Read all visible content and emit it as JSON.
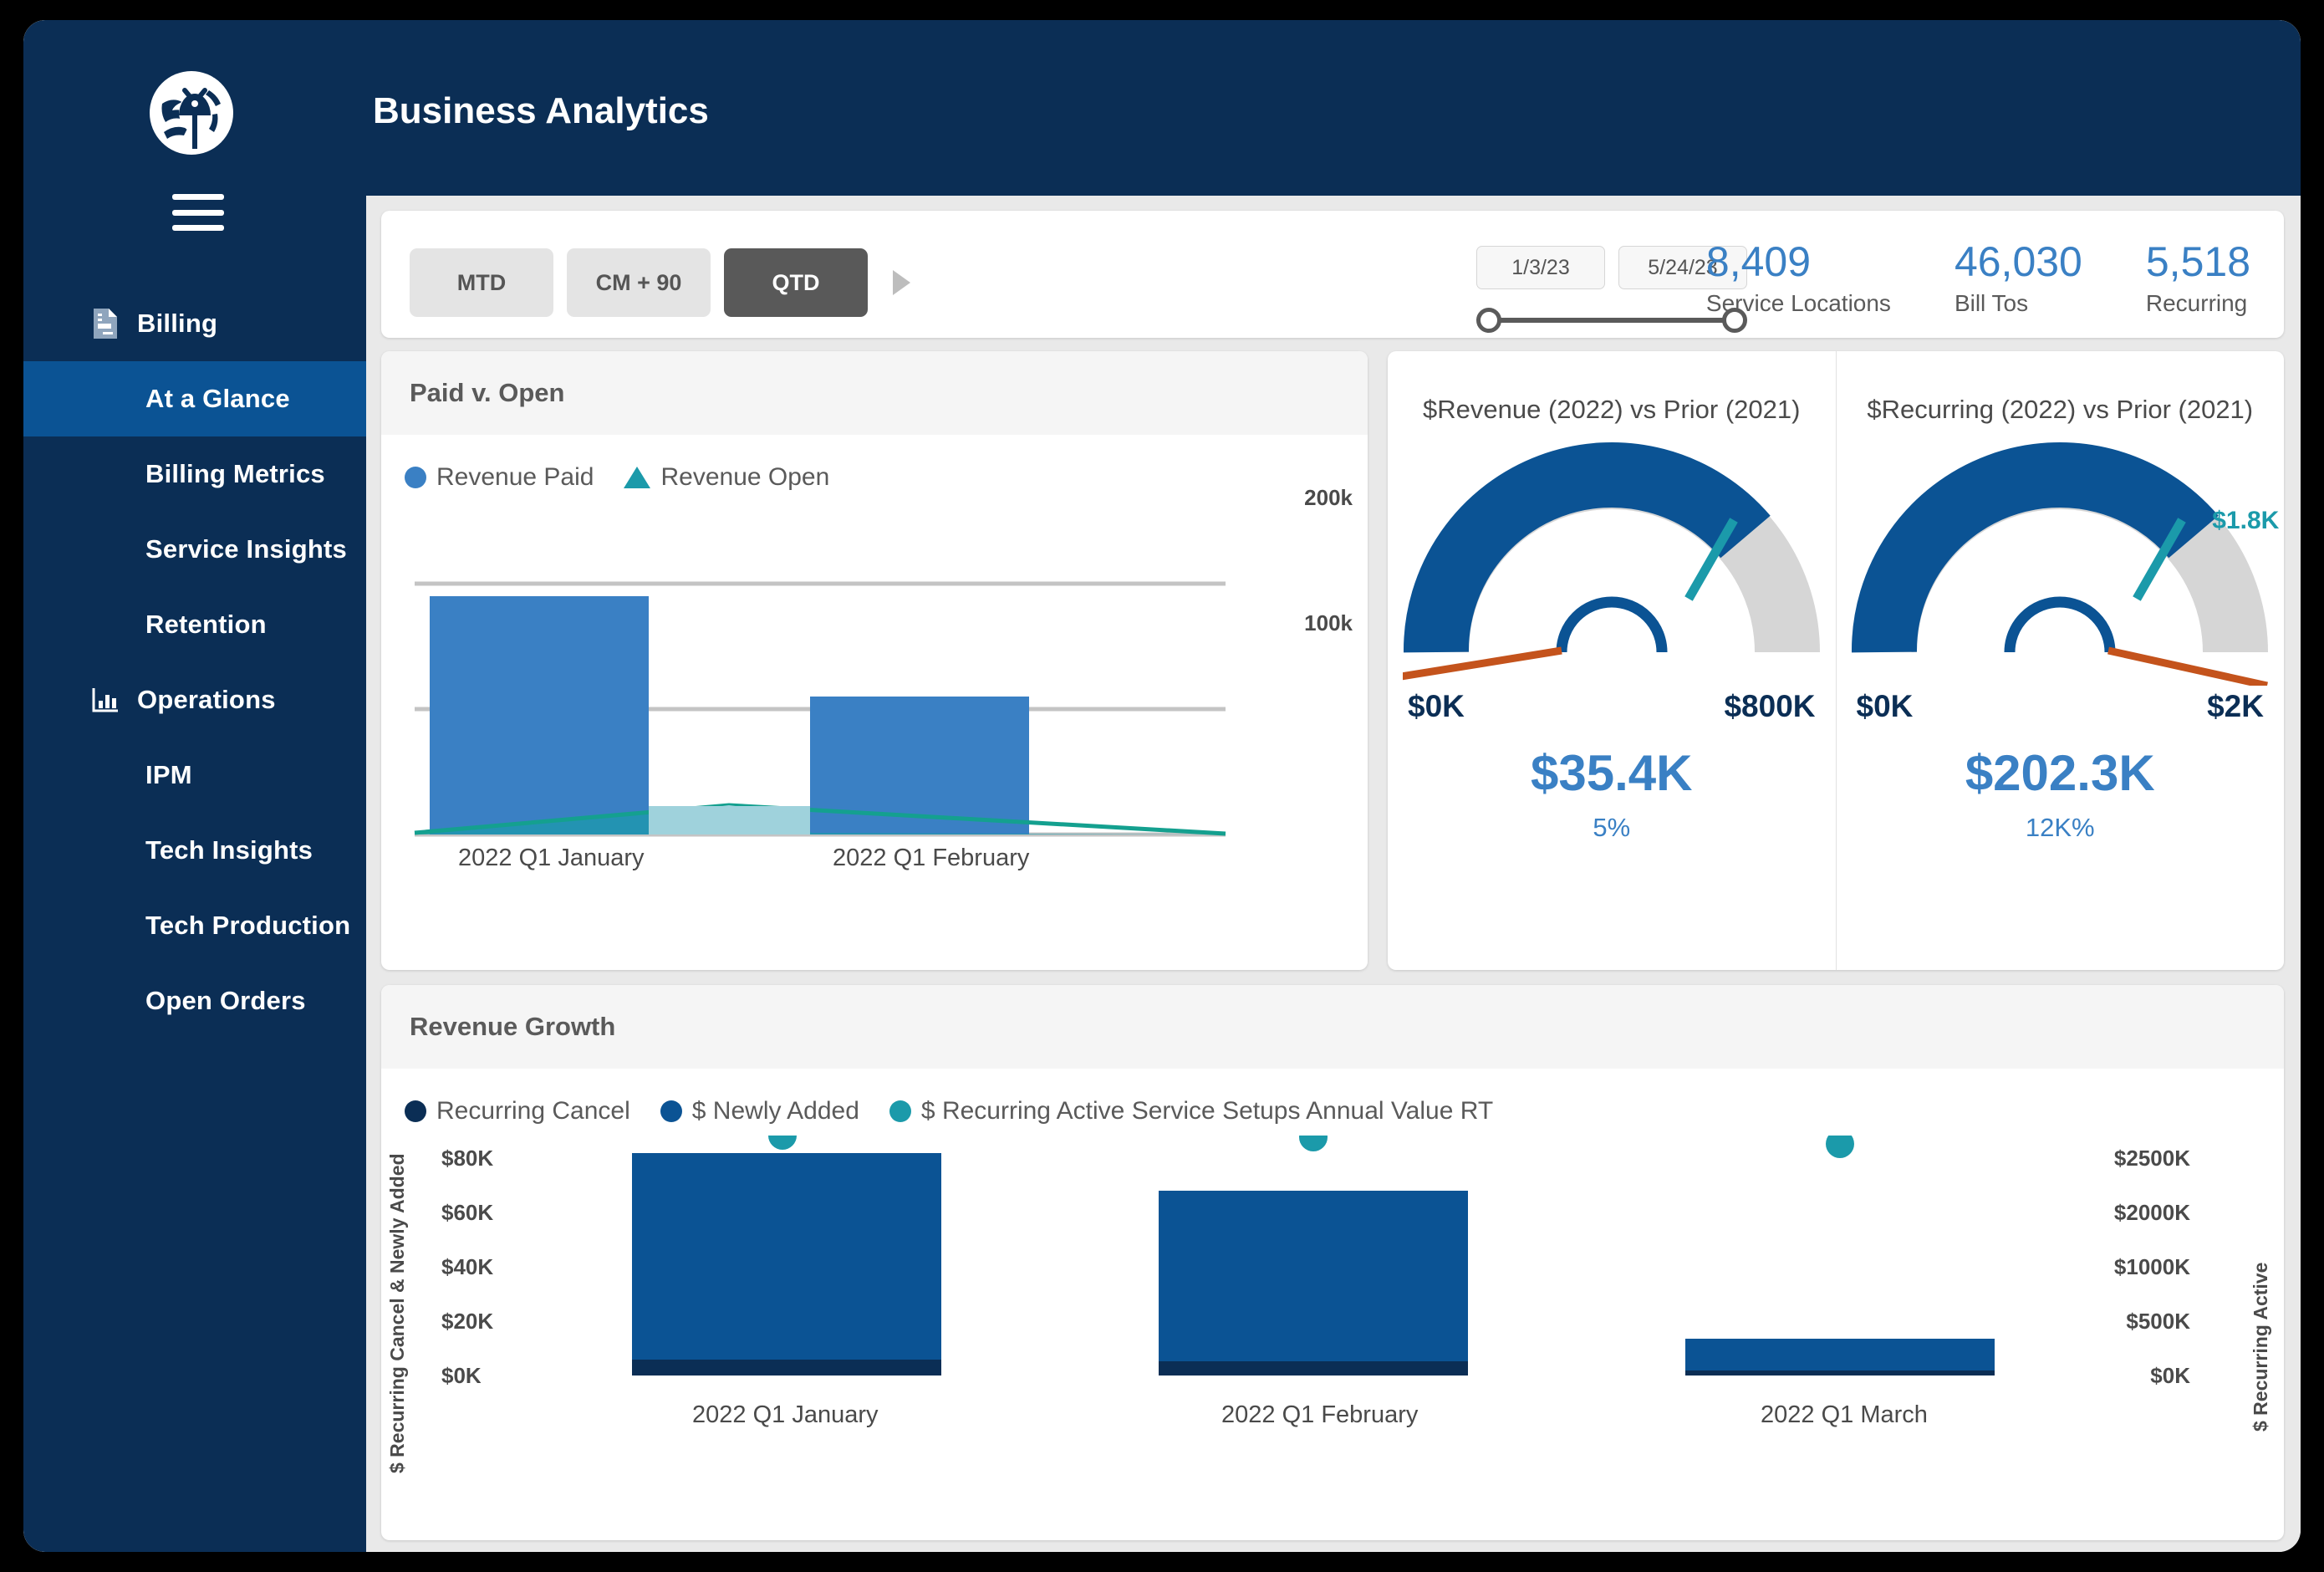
{
  "app": {
    "logo_icon": "globe-bug-logo",
    "menu_icon": "hamburger-menu-icon",
    "header_title": "Business Analytics"
  },
  "sidebar": {
    "items": [
      {
        "label": "Billing",
        "icon": "document-icon",
        "level": "section",
        "active": false
      },
      {
        "label": "At a Glance",
        "icon": "",
        "level": "child",
        "active": true
      },
      {
        "label": "Billing Metrics",
        "icon": "",
        "level": "child",
        "active": false
      },
      {
        "label": "Service Insights",
        "icon": "",
        "level": "child",
        "active": false
      },
      {
        "label": "Retention",
        "icon": "",
        "level": "child",
        "active": false
      },
      {
        "label": "Operations",
        "icon": "bar-chart-icon",
        "level": "section",
        "active": false
      },
      {
        "label": "IPM",
        "icon": "",
        "level": "child",
        "active": false
      },
      {
        "label": "Tech Insights",
        "icon": "",
        "level": "child",
        "active": false
      },
      {
        "label": "Tech Production",
        "icon": "",
        "level": "child",
        "active": false
      },
      {
        "label": "Open Orders",
        "icon": "",
        "level": "child",
        "active": false
      }
    ]
  },
  "filterbar": {
    "period_pills": [
      {
        "label": "MTD",
        "selected": false
      },
      {
        "label": "CM + 90",
        "selected": false
      },
      {
        "label": "QTD",
        "selected": true
      }
    ],
    "more_icon": "chevron-right-icon",
    "date_start": "1/3/23",
    "date_end": "5/24/23",
    "kpis": [
      {
        "value": "8,409",
        "label": "Service Locations"
      },
      {
        "value": "46,030",
        "label": "Bill Tos"
      },
      {
        "value": "5,518",
        "label": "Recurring"
      }
    ]
  },
  "gauges": [
    {
      "title": "$Revenue (2022) vs Prior (2021)",
      "min_label": "$0K",
      "max_label": "$800K",
      "value_label": "$35.4K",
      "pct_label": "5%",
      "target_label": "",
      "fill_fraction": 0.78,
      "target_fraction": 0.78,
      "needle_fraction": 0.06
    },
    {
      "title": "$Recurring (2022) vs Prior (2021)",
      "min_label": "$0K",
      "max_label": "$2K",
      "value_label": "$202.3K",
      "pct_label": "12K%",
      "target_label": "$1.8K",
      "fill_fraction": 0.78,
      "target_fraction": 0.78,
      "needle_fraction": 0.93
    }
  ],
  "colors": {
    "brand_navy": "#0b2e55",
    "accent_blue": "#3a80c4",
    "gauge_blue": "#0b5394",
    "teal": "#1b9aaa",
    "orange": "#c4531c",
    "grey_track": "#d6d6d6"
  },
  "chart_data": [
    {
      "id": "paid_v_open",
      "type": "bar",
      "title": "Paid v. Open",
      "categories": [
        "2022 Q1 January",
        "2022 Q1 February"
      ],
      "series": [
        {
          "name": "Revenue Paid",
          "type": "bar",
          "color": "#3a80c4",
          "values": [
            190000,
            105000
          ]
        },
        {
          "name": "Revenue Open",
          "type": "area",
          "color": "#1b9aaa",
          "values": [
            1500,
            1000
          ],
          "peak_value": 22000
        }
      ],
      "ylabel": "",
      "ytick_labels": [
        "100k",
        "200k"
      ],
      "ytick_values": [
        100000,
        200000
      ],
      "ylim": [
        0,
        230000
      ],
      "grid": true,
      "legend_position": "top-left"
    },
    {
      "id": "revenue_growth",
      "type": "bar",
      "title": "Revenue Growth",
      "categories": [
        "2022 Q1 January",
        "2022 Q1 February",
        "2022 Q1 March"
      ],
      "series": [
        {
          "name": "Recurring Cancel",
          "type": "bar",
          "color": "#0b2e55",
          "axis": "left",
          "values": [
            6000,
            5000,
            1500
          ]
        },
        {
          "name": "$ Newly Added",
          "type": "bar",
          "color": "#0b5394",
          "axis": "left",
          "values": [
            80000,
            62000,
            13000
          ]
        },
        {
          "name": "$ Recurring Active Service Setups Annual Value RT",
          "type": "scatter",
          "color": "#1b9aaa",
          "axis": "right",
          "values": [
            2450,
            2440,
            2350
          ]
        }
      ],
      "left_axis_title": "$ Recurring Cancel & Newly Added",
      "left_tick_labels": [
        "$0K",
        "$20K",
        "$40K",
        "$60K",
        "$80K"
      ],
      "right_axis_title": "$ Recurring Active",
      "right_tick_labels": [
        "$0K",
        "$500K",
        "$1000K",
        "$2000K",
        "$2500K"
      ],
      "grid": false,
      "legend_position": "top-left"
    }
  ]
}
